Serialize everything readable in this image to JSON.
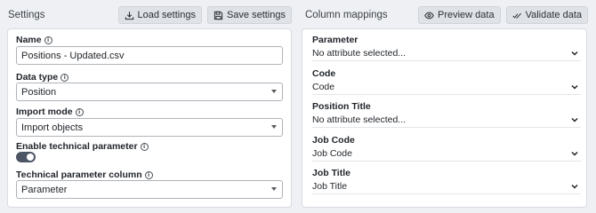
{
  "settings": {
    "title": "Settings",
    "load_button": "Load settings",
    "save_button": "Save settings",
    "name_label": "Name",
    "name_value": "Positions - Updated.csv",
    "data_type_label": "Data type",
    "data_type_value": "Position",
    "import_mode_label": "Import mode",
    "import_mode_value": "Import objects",
    "enable_tech_label": "Enable technical parameter",
    "enable_tech_on": true,
    "tech_column_label": "Technical parameter column",
    "tech_column_value": "Parameter"
  },
  "mappings": {
    "title": "Column mappings",
    "preview_button": "Preview data",
    "validate_button": "Validate data",
    "rows": [
      {
        "label": "Parameter",
        "value": "No attribute selected..."
      },
      {
        "label": "Code",
        "value": "Code"
      },
      {
        "label": "Position Title",
        "value": "No attribute selected..."
      },
      {
        "label": "Job Code",
        "value": "Job Code"
      },
      {
        "label": "Job Title",
        "value": "Job Title"
      }
    ]
  },
  "icons": {
    "load": "download-tray-icon",
    "save": "floppy-disk-icon",
    "preview": "eye-icon",
    "validate": "double-check-icon",
    "info": "info-circle-icon",
    "select": "chevron-down-icon"
  }
}
